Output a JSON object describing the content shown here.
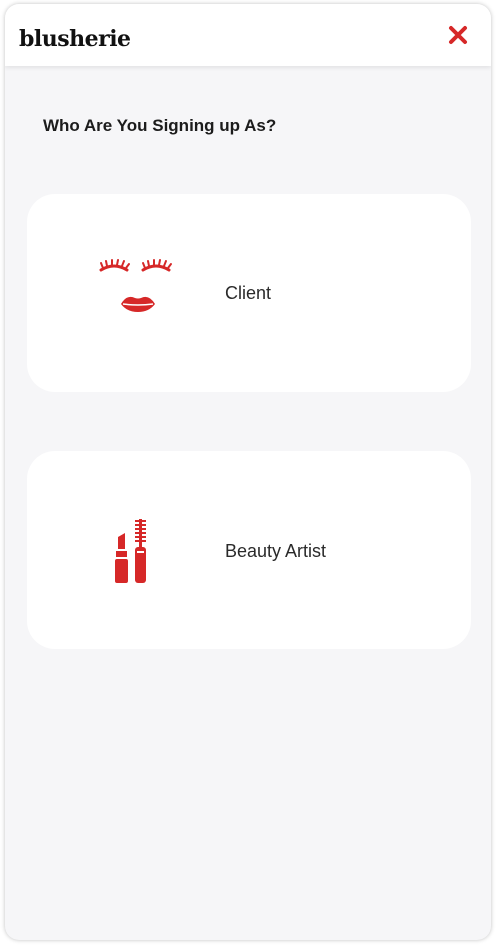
{
  "header": {
    "logo": "blusherie",
    "close_icon": "close-x-icon"
  },
  "heading": "Who Are You Signing up As?",
  "options": [
    {
      "label": "Client",
      "icon": "eyelashes-lips-icon"
    },
    {
      "label": "Beauty Artist",
      "icon": "lipstick-mascara-icon"
    }
  ],
  "colors": {
    "accent": "#d62828",
    "background": "#f6f6f8",
    "card": "#ffffff",
    "text": "#1c1c1c"
  }
}
